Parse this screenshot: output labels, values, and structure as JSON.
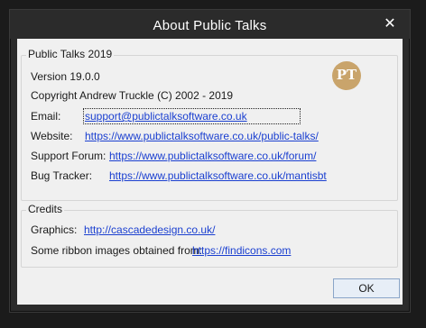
{
  "window": {
    "title": "About Public Talks",
    "close_glyph": "✕"
  },
  "app_group": {
    "title": "Public Talks 2019",
    "version": "Version 19.0.0",
    "copyright": "Copyright Andrew Truckle (C) 2002 - 2019",
    "logo_text": "PT",
    "rows": [
      {
        "label": "Email:",
        "value": "support@publictalksoftware.co.uk"
      },
      {
        "label": "Website:",
        "value": "https://www.publictalksoftware.co.uk/public-talks/"
      },
      {
        "label": "Support Forum:",
        "value": "https://www.publictalksoftware.co.uk/forum/"
      },
      {
        "label": "Bug Tracker:",
        "value": "https://www.publictalksoftware.co.uk/mantisbt"
      }
    ]
  },
  "credits_group": {
    "title": "Credits",
    "rows": [
      {
        "label": "Graphics:",
        "value": "http://cascadedesign.co.uk/"
      },
      {
        "label": "Some ribbon images obtained from:",
        "value": "https://findicons.com"
      }
    ]
  },
  "buttons": {
    "ok": "OK"
  },
  "colors": {
    "frame": "#2b2b2b",
    "client": "#f0f0f0",
    "link": "#1a3fd0",
    "logo": "#c9a46b"
  }
}
